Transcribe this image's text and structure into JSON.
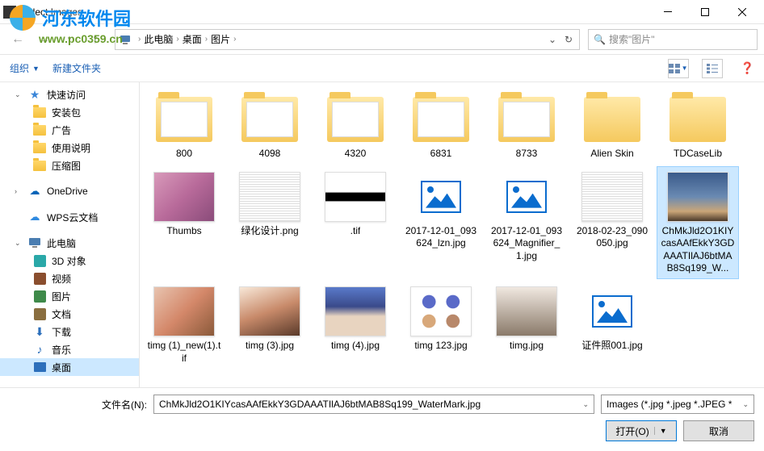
{
  "watermark": {
    "text": "河东软件园",
    "url": "www.pc0359.cn"
  },
  "title": "Select Images",
  "breadcrumb": {
    "parts": [
      "此电脑",
      "桌面",
      "图片"
    ]
  },
  "search": {
    "placeholder": "搜索\"图片\""
  },
  "toolbar": {
    "organize": "组织",
    "new_folder": "新建文件夹"
  },
  "sidebar": {
    "quick_access": "快速访问",
    "items_quick": [
      "安装包",
      "广告",
      "使用说明",
      "压缩图"
    ],
    "onedrive": "OneDrive",
    "wps": "WPS云文档",
    "this_pc": "此电脑",
    "items_pc": [
      "3D 对象",
      "视频",
      "图片",
      "文档",
      "下载",
      "音乐",
      "桌面"
    ]
  },
  "files": [
    {
      "name": "800",
      "type": "folder-preview"
    },
    {
      "name": "4098",
      "type": "folder-preview"
    },
    {
      "name": "4320",
      "type": "folder-preview"
    },
    {
      "name": "6831",
      "type": "folder-preview"
    },
    {
      "name": "8733",
      "type": "folder-preview"
    },
    {
      "name": "Alien Skin",
      "type": "folder"
    },
    {
      "name": "TDCaseLib",
      "type": "folder"
    },
    {
      "name": "Thumbs",
      "type": "photo",
      "variant": "thumbs"
    },
    {
      "name": "绿化设计.png",
      "type": "photo",
      "variant": "docgrid"
    },
    {
      "name": ".tif",
      "type": "photo",
      "variant": "bw"
    },
    {
      "name": "2017-12-01_093624_lzn.jpg",
      "type": "placeholder"
    },
    {
      "name": "2017-12-01_093624_Magnifier_1.jpg",
      "type": "placeholder"
    },
    {
      "name": "2018-02-23_090050.jpg",
      "type": "photo",
      "variant": "docgrid"
    },
    {
      "name": "ChMkJld2O1KIYcasAAfEkkY3GDAAATIlAJ6btMAB8Sq199_W...",
      "type": "photo",
      "variant": "sky",
      "selected": true
    },
    {
      "name": "timg (1)_new(1).tif",
      "type": "photo",
      "variant": "girl1"
    },
    {
      "name": "timg (3).jpg",
      "type": "photo",
      "variant": "girl2"
    },
    {
      "name": "timg (4).jpg",
      "type": "photo",
      "variant": "girl3"
    },
    {
      "name": "timg 123.jpg",
      "type": "photo",
      "variant": "circles"
    },
    {
      "name": "timg.jpg",
      "type": "photo",
      "variant": "girl4"
    },
    {
      "name": "证件照001.jpg",
      "type": "placeholder"
    }
  ],
  "footer": {
    "filename_label": "文件名(N):",
    "filename_value": "ChMkJld2O1KIYcasAAfEkkY3GDAAATIlAJ6btMAB8Sq199_WaterMark.jpg",
    "filter": "Images (*.jpg *.jpeg *.JPEG *",
    "open": "打开(O)",
    "cancel": "取消"
  }
}
